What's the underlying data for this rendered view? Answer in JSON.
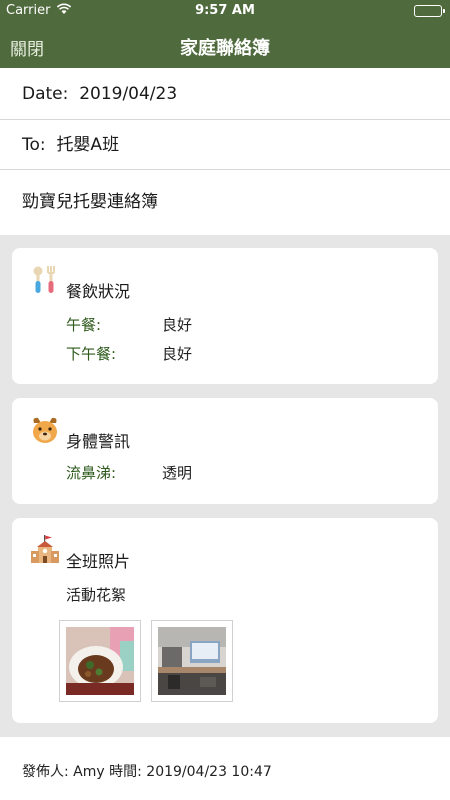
{
  "status_bar": {
    "carrier": "Carrier",
    "time": "9:57 AM"
  },
  "nav": {
    "close_label": "關閉",
    "title": "家庭聯絡簿"
  },
  "header": {
    "date_label": "Date:",
    "date_value": "2019/04/23",
    "to_label": "To:",
    "to_value": "托嬰A班",
    "subject": "勁寶兒托嬰連絡簿"
  },
  "cards": {
    "meal": {
      "icon": "utensils-icon",
      "title": "餐飲狀況",
      "rows": [
        {
          "key": "午餐:",
          "value": "良好"
        },
        {
          "key": "下午餐:",
          "value": "良好"
        }
      ]
    },
    "health": {
      "icon": "dog-icon",
      "title": "身體警訊",
      "rows": [
        {
          "key": "流鼻涕:",
          "value": "透明"
        }
      ]
    },
    "photos": {
      "icon": "school-icon",
      "title": "全班照片",
      "caption": "活動花絮",
      "thumbnails": [
        "food-photo",
        "classroom-photo"
      ]
    }
  },
  "footer": {
    "posted_by": "發佈人: Amy 時間: 2019/04/23 10:47"
  },
  "colors": {
    "header_green": "#4f6a3d",
    "key_green": "#2e5a1c",
    "feed_gray": "#e6e6e6"
  }
}
